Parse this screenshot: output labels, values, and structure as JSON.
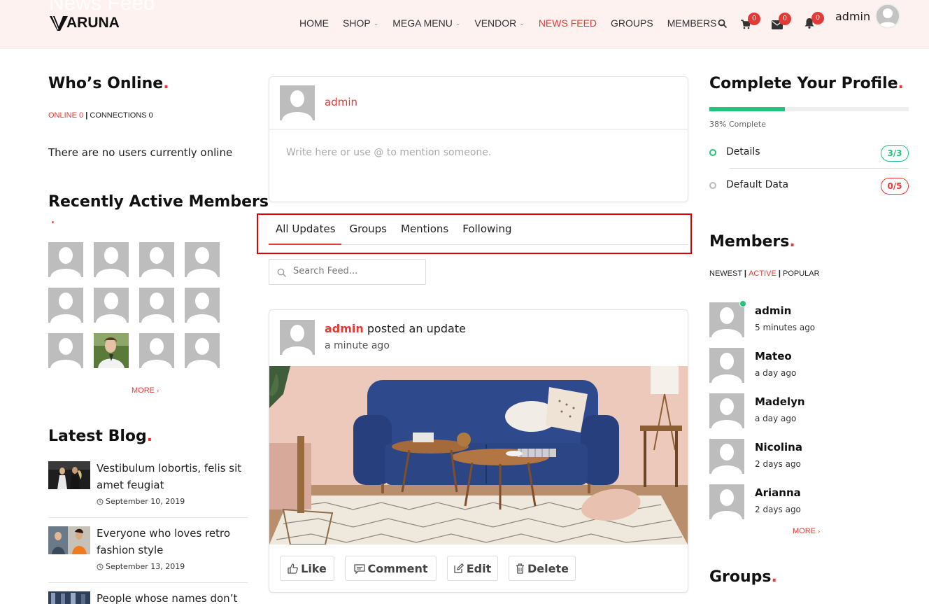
{
  "header": {
    "ghost_title": "News Feed",
    "logo": "ARUNA",
    "nav": [
      {
        "label": "HOME",
        "dropdown": false,
        "active": false
      },
      {
        "label": "SHOP",
        "dropdown": true,
        "active": false
      },
      {
        "label": "MEGA MENU",
        "dropdown": true,
        "active": false
      },
      {
        "label": "VENDOR",
        "dropdown": true,
        "active": false
      },
      {
        "label": "NEWS FEED",
        "dropdown": false,
        "active": true
      },
      {
        "label": "GROUPS",
        "dropdown": false,
        "active": false
      },
      {
        "label": "MEMBERS",
        "dropdown": true,
        "active": false
      }
    ],
    "cart_count": "0",
    "messages_count": "0",
    "notifications_count": "0",
    "username": "admin"
  },
  "left": {
    "online_title": "Who’s Online",
    "online_tab": "ONLINE 0",
    "connections_tab": "CONNECTIONS 0",
    "no_users": "There are no users currently online",
    "recent_title": "Recently Active Members",
    "more": "MORE",
    "blog_title": "Latest Blog",
    "blog": [
      {
        "title": "Vestibulum lobortis, felis sit amet feugiat",
        "date": "September 10, 2019"
      },
      {
        "title": "Everyone who loves retro fashion style",
        "date": "September 13, 2019"
      },
      {
        "title": "People whose names don’t",
        "date": ""
      }
    ]
  },
  "center": {
    "composer_user": "admin",
    "composer_placeholder": "Write here or use @ to mention someone.",
    "tabs": [
      "All Updates",
      "Groups",
      "Mentions",
      "Following"
    ],
    "search_placeholder": "Search Feed...",
    "post": {
      "author": "admin",
      "action": "posted an update",
      "time": "a minute ago"
    },
    "actions": {
      "like": "Like",
      "comment": "Comment",
      "edit": "Edit",
      "delete": "Delete"
    }
  },
  "right": {
    "profile_title": "Complete Your Profile",
    "progress_percent": 38,
    "progress_text": "38% Complete",
    "items": [
      {
        "label": "Details",
        "score": "3/3",
        "color": "#22c37a"
      },
      {
        "label": "Default Data",
        "score": "0/5",
        "color": "#e53935"
      }
    ],
    "members_title": "Members",
    "filter_newest": "NEWEST",
    "filter_active": "ACTIVE",
    "filter_popular": "POPULAR",
    "members": [
      {
        "name": "admin",
        "time": "5 minutes ago"
      },
      {
        "name": "Mateo",
        "time": "a day ago"
      },
      {
        "name": "Madelyn",
        "time": "a day ago"
      },
      {
        "name": "Nicolina",
        "time": "2 days ago"
      },
      {
        "name": "Arianna",
        "time": "2 days ago"
      }
    ],
    "more": "MORE",
    "groups_title": "Groups"
  },
  "colors": {
    "accent": "#e53935",
    "success": "#22c37a",
    "highlight_box": "#e00000"
  }
}
